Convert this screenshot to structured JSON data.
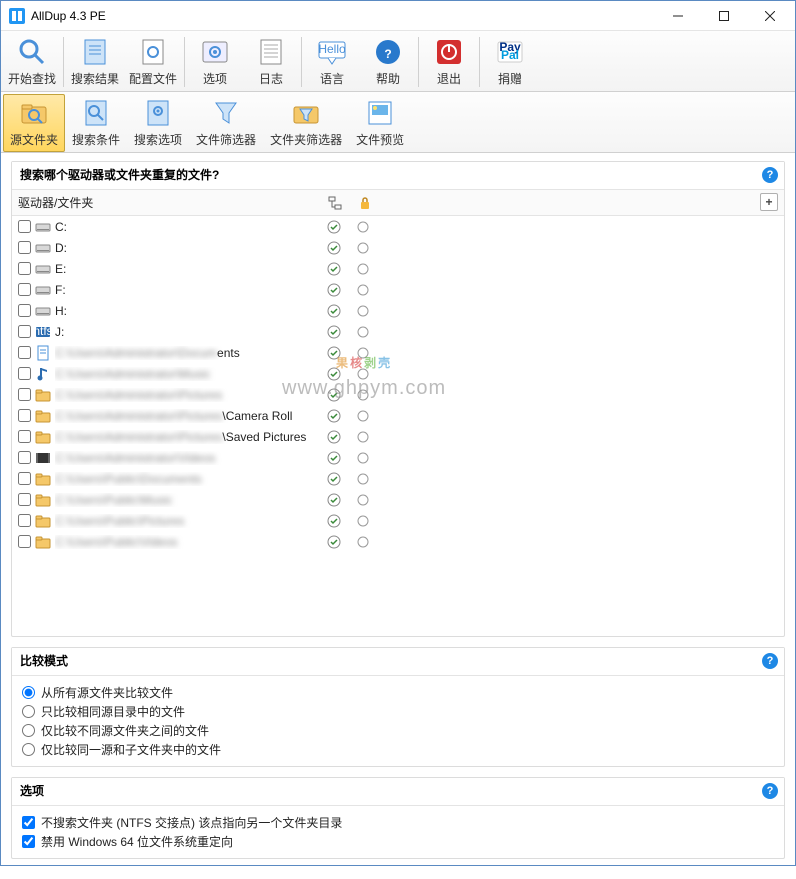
{
  "window": {
    "title": "AllDup 4.3 PE"
  },
  "toolbar": {
    "items": [
      {
        "key": "start-search",
        "label": "开始查找"
      },
      {
        "key": "search-results",
        "label": "搜索结果"
      },
      {
        "key": "config-file",
        "label": "配置文件"
      },
      {
        "key": "options",
        "label": "选项"
      },
      {
        "key": "log",
        "label": "日志"
      },
      {
        "key": "language",
        "label": "语言"
      },
      {
        "key": "help",
        "label": "帮助"
      },
      {
        "key": "exit",
        "label": "退出"
      },
      {
        "key": "donate",
        "label": "捐赠"
      }
    ]
  },
  "ribbon": {
    "items": [
      {
        "key": "source-folders",
        "label": "源文件夹",
        "active": true
      },
      {
        "key": "search-criteria",
        "label": "搜索条件"
      },
      {
        "key": "search-options",
        "label": "搜索选项"
      },
      {
        "key": "file-filter",
        "label": "文件筛选器"
      },
      {
        "key": "folder-filter",
        "label": "文件夹筛选器"
      },
      {
        "key": "file-preview",
        "label": "文件预览"
      }
    ]
  },
  "sourcePanel": {
    "title": "搜索哪个驱动器或文件夹重复的文件?",
    "colHeader": "驱动器/文件夹",
    "rows": [
      {
        "icon": "drive",
        "name": "C:",
        "checked": true
      },
      {
        "icon": "drive",
        "name": "D:",
        "checked": true
      },
      {
        "icon": "drive",
        "name": "E:",
        "checked": true
      },
      {
        "icon": "drive",
        "name": "F:",
        "checked": true
      },
      {
        "icon": "drive",
        "name": "H:",
        "checked": true
      },
      {
        "icon": "drive-blue",
        "name": "J:",
        "checked": true
      },
      {
        "icon": "doc",
        "name": "C:\\Users\\Administrator\\Documents",
        "blur": true,
        "suffix": "ents",
        "checked": true
      },
      {
        "icon": "music",
        "name": "C:\\Users\\Administrator\\Music",
        "blur": true,
        "checked": true
      },
      {
        "icon": "folder",
        "name": "C:\\Users\\Administrator\\Pictures",
        "blur": true,
        "checked": true
      },
      {
        "icon": "folder",
        "name": "C:\\Users\\Administrator\\Pictures\\Camera Roll",
        "blur": true,
        "suffix": "\\Camera Roll",
        "checked": true
      },
      {
        "icon": "folder",
        "name": "C:\\Users\\Administrator\\Pictures\\Saved Pictures",
        "blur": true,
        "suffix": "\\Saved Pictures",
        "checked": true
      },
      {
        "icon": "video",
        "name": "C:\\Users\\Administrator\\Videos",
        "blur": true,
        "checked": true
      },
      {
        "icon": "folder",
        "name": "C:\\Users\\Public\\Documents",
        "blur": true,
        "checked": true
      },
      {
        "icon": "folder",
        "name": "C:\\Users\\Public\\Music",
        "blur": true,
        "checked": true
      },
      {
        "icon": "folder",
        "name": "C:\\Users\\Public\\Pictures",
        "blur": true,
        "checked": true
      },
      {
        "icon": "folder",
        "name": "C:\\Users\\Public\\Videos",
        "blur": true,
        "checked": true
      }
    ]
  },
  "compareMode": {
    "title": "比较模式",
    "options": [
      "从所有源文件夹比较文件",
      "只比较相同源目录中的文件",
      "仅比较不同源文件夹之间的文件",
      "仅比较同一源和子文件夹中的文件"
    ],
    "selected": 0
  },
  "optionsPanel": {
    "title": "选项",
    "items": [
      "不搜索文件夹 (NTFS 交接点) 该点指向另一个文件夹目录",
      "禁用 Windows 64 位文件系统重定向"
    ]
  },
  "watermark": {
    "line1": "www.ghpym.com"
  }
}
